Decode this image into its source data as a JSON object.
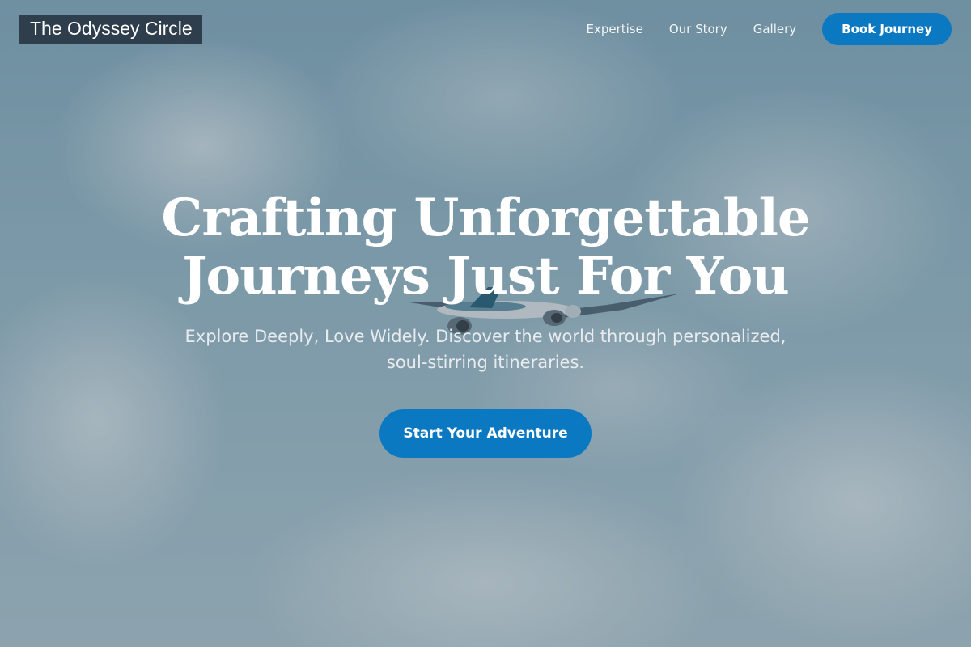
{
  "brand": {
    "name": "The Odyssey Circle"
  },
  "nav": {
    "links": [
      "Expertise",
      "Our Story",
      "Gallery"
    ],
    "cta_label": "Book Journey"
  },
  "hero": {
    "title_line1": "Crafting Unforgettable",
    "title_line2": "Journeys Just For You",
    "subtitle": "Explore Deeply, Love Widely. Discover the world through personalized, soul-stirring itineraries.",
    "cta_label": "Start Your Adventure",
    "background": "sky-with-clouds-and-airplane-image"
  },
  "colors": {
    "accent": "#0b78c2",
    "logo_bg": "#2f3e4d"
  }
}
